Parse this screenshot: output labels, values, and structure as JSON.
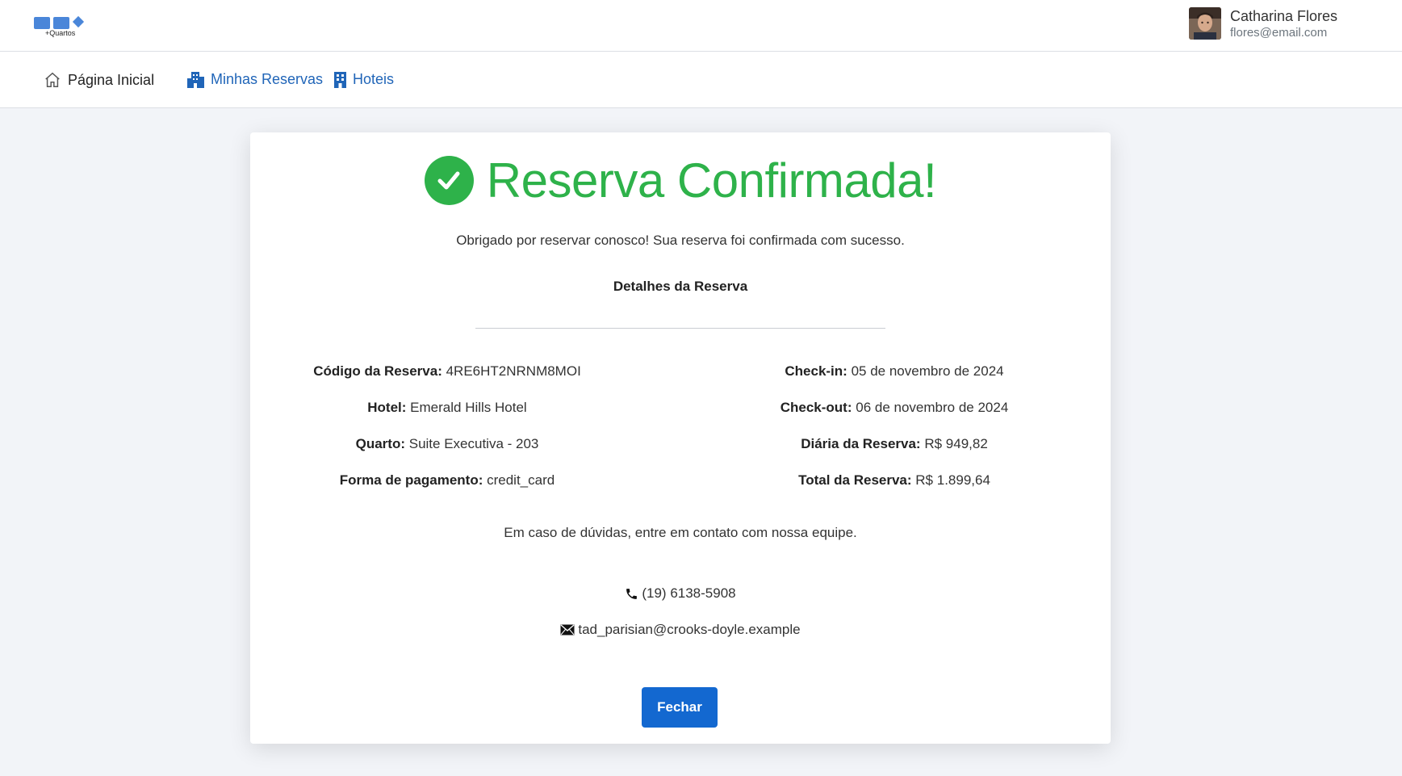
{
  "header": {
    "logo_text": "+Quartos",
    "user": {
      "name": "Catharina Flores",
      "email": "flores@email.com"
    }
  },
  "nav": {
    "items": [
      {
        "label": "Página Inicial",
        "icon": "home-icon"
      },
      {
        "label": "Minhas Reservas",
        "icon": "buildings-icon"
      },
      {
        "label": "Hoteis",
        "icon": "hotel-icon"
      }
    ]
  },
  "confirmation": {
    "title": "Reserva Confirmada!",
    "message": "Obrigado por reservar conosco! Sua reserva foi confirmada com sucesso.",
    "details_heading": "Detalhes da Reserva",
    "left": [
      {
        "label": "Código da Reserva:",
        "value": "4RE6HT2NRNM8MOI"
      },
      {
        "label": "Hotel:",
        "value": "Emerald Hills Hotel"
      },
      {
        "label": "Quarto:",
        "value": "Suite Executiva - 203"
      },
      {
        "label": "Forma de pagamento:",
        "value": "credit_card"
      }
    ],
    "right": [
      {
        "label": "Check-in:",
        "value": "05 de novembro de 2024"
      },
      {
        "label": "Check-out:",
        "value": "06 de novembro de 2024"
      },
      {
        "label": "Diária da Reserva:",
        "value": "R$ 949,82"
      },
      {
        "label": "Total da Reserva:",
        "value": "R$ 1.899,64"
      }
    ],
    "contact_text": "Em caso de dúvidas, entre em contato com nossa equipe.",
    "phone": "(19) 6138-5908",
    "email": "tad_parisian@crooks-doyle.example",
    "close_label": "Fechar"
  },
  "colors": {
    "success": "#2eb24a",
    "primary": "#1368d0",
    "link": "#2065b8"
  }
}
